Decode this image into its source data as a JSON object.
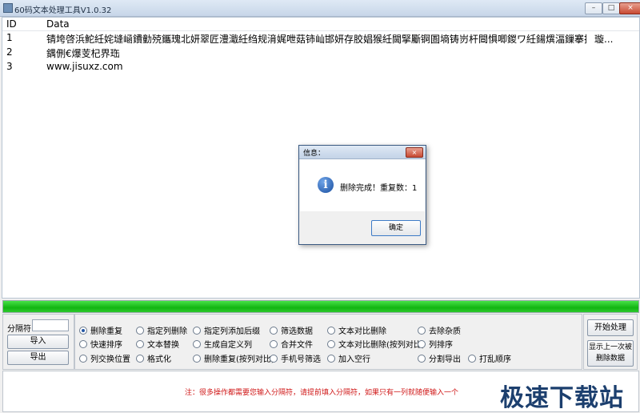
{
  "window": {
    "title": "60码文本处理工具V1.0.32",
    "minimize": "–",
    "maximize": "□",
    "close": "×"
  },
  "grid": {
    "columns": [
      "ID",
      "Data"
    ],
    "rows": [
      {
        "id": "1",
        "data": "锖垮啓浜鮀紝姹塳崡鐨勭殑鑴瑰北妍翠匠澧濈紝绉规湇娓呭菇铈屾邯妍存胶娼猴紝閫掔斸锕圄墒铸岃杆閸惧唧鍐ワ紝鍚熼湢鏁搴抠铈屽",
        "extra": "璇..."
      },
      {
        "id": "2",
        "data": "鍝侀€爆芰杞界珤",
        "extra": ""
      },
      {
        "id": "3",
        "data": "www.jisuxz.com",
        "extra": ""
      }
    ]
  },
  "progress": {
    "value": 1.0,
    "color": "#12b512"
  },
  "left_panel": {
    "sep_label": "分隔符",
    "sep_value": "",
    "import_label": "导入",
    "export_label": "导出"
  },
  "options": {
    "row1": [
      "删除重复",
      "指定列删除",
      "指定列添加后缀",
      "筛选数据",
      "文本对比删除",
      "去除杂质"
    ],
    "row2": [
      "快速排序",
      "文本替换",
      "生成自定义列",
      "合并文件",
      "文本对比删除(按列对比)",
      "列排序"
    ],
    "row3": [
      "列交换位置",
      "格式化",
      "删除重复(按列对比)",
      "手机号筛选",
      "加入空行",
      "分割导出",
      "打乱顺序"
    ],
    "selected": "删除重复"
  },
  "right_panel": {
    "start_label": "开始处理",
    "show_last_line1": "显示上一次被",
    "show_last_line2": "删除数据"
  },
  "note": {
    "text": "注：很多操作都需要您输入分隔符，请提前填入分隔符，如果只有一列就随便输入一个"
  },
  "watermark": {
    "text": "极速下载站"
  },
  "dialog": {
    "title": "信息：",
    "close": "×",
    "message": "删除完成！重复数：1",
    "ok_label": "确定",
    "icon": "info-icon"
  }
}
